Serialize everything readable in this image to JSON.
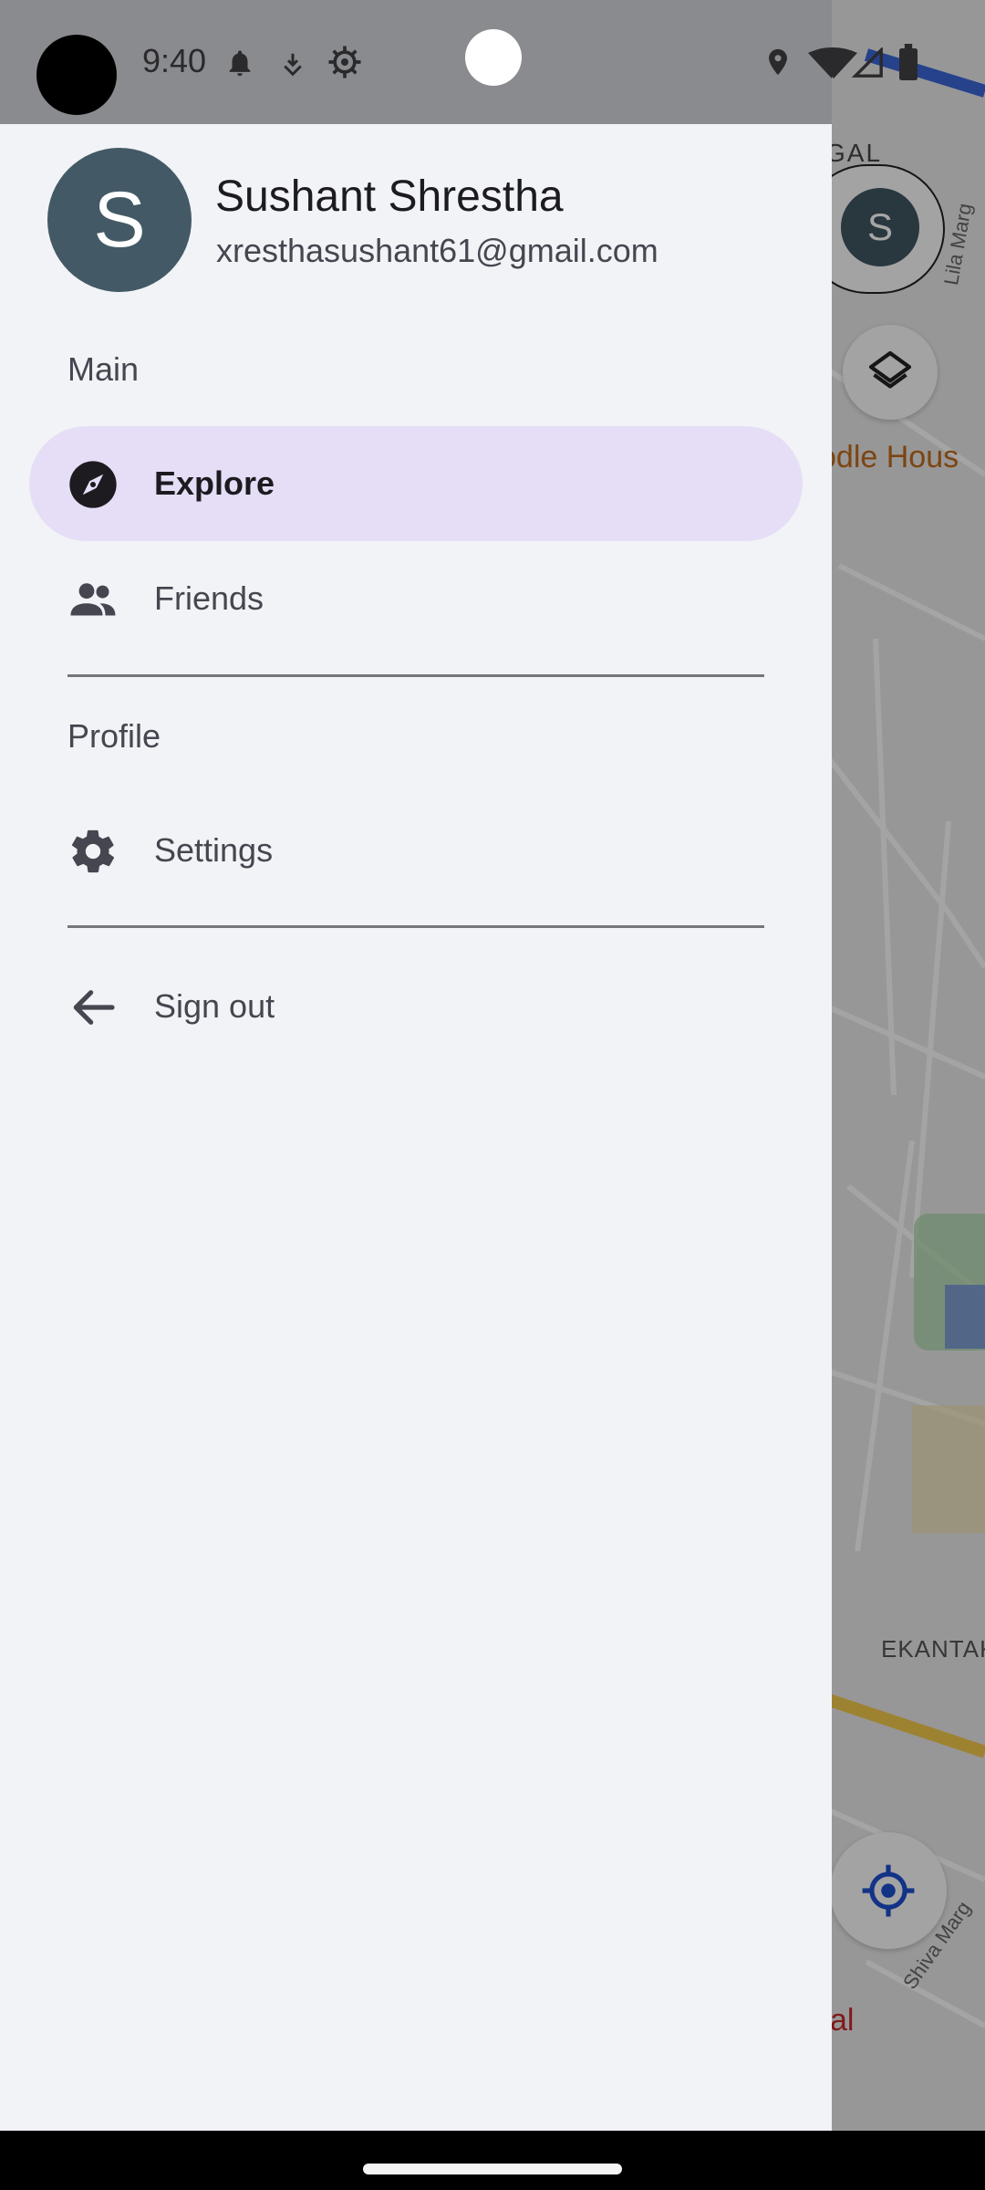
{
  "status_bar": {
    "time": "9:40",
    "left_icons": [
      "bell-icon",
      "download-icon",
      "settings-sync-icon"
    ],
    "right_icons": [
      "location-icon",
      "wifi-icon",
      "signal-icon",
      "battery-icon"
    ]
  },
  "profile": {
    "avatar_initial": "S",
    "name": "Sushant Shrestha",
    "email": "xresthasushant61@gmail.com"
  },
  "sections": {
    "main": "Main",
    "profile": "Profile"
  },
  "nav": {
    "explore": {
      "label": "Explore",
      "icon": "compass-icon",
      "selected": true
    },
    "friends": {
      "label": "Friends",
      "icon": "people-icon",
      "selected": false
    },
    "settings": {
      "label": "Settings",
      "icon": "gear-icon",
      "selected": false
    },
    "sign_out": {
      "label": "Sign out",
      "icon": "arrow-back-icon",
      "selected": false
    }
  },
  "map": {
    "avatar_initial": "S",
    "labels": {
      "gal": "GAL",
      "poi": "odle Hous",
      "road_lila": "Lila Marg",
      "neighborhood": "EKANTAK",
      "road_shiva": "Shiva Marg",
      "red_label": "al"
    }
  },
  "colors": {
    "drawer_bg": "#f2f3f7",
    "active_item_bg": "#e6def6",
    "avatar_bg": "#435a66",
    "accent_blue": "#1e4fd0"
  }
}
